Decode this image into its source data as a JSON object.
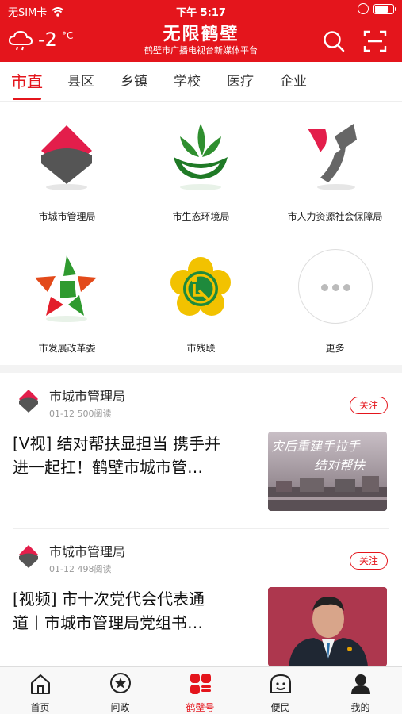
{
  "status_bar": {
    "carrier": "无SIM卡",
    "time": "下午 5:17"
  },
  "header": {
    "temperature": "-2",
    "unit": "°C",
    "app_name": "无限鹤壁",
    "subtitle": "鹤壁市广播电视台新媒体平台",
    "icons": {
      "weather": "cloud-icon",
      "search": "search-icon",
      "scan": "scan-icon"
    },
    "color": "#e4151c"
  },
  "tabs": [
    {
      "label": "市直",
      "active": true
    },
    {
      "label": "县区"
    },
    {
      "label": "乡镇"
    },
    {
      "label": "学校"
    },
    {
      "label": "医疗"
    },
    {
      "label": "企业"
    }
  ],
  "accounts": [
    {
      "label": "市城市管理局",
      "icon": "city-management-logo"
    },
    {
      "label": "市生态环境局",
      "icon": "ecology-logo"
    },
    {
      "label": "市人力资源社会保障局",
      "icon": "hr-social-security-logo"
    },
    {
      "label": "市发展改革委",
      "icon": "development-reform-logo"
    },
    {
      "label": "市残联",
      "icon": "disabled-federation-logo"
    },
    {
      "label": "更多",
      "icon": "more-icon"
    }
  ],
  "articles": [
    {
      "source": "市城市管理局",
      "date": "01-12",
      "reads": "500阅读",
      "follow": "关注",
      "title_line1": "[V视] 结对帮扶显担当 携手并",
      "title_line2": "进一起扛！鹤壁市城市管…",
      "thumb_text1": "灾后重建手拉手",
      "thumb_text2": "结对帮扶"
    },
    {
      "source": "市城市管理局",
      "date": "01-12",
      "reads": "498阅读",
      "follow": "关注",
      "title_line1": "[视频] 市十次党代会代表通",
      "title_line2": "道丨市城市管理局党组书…"
    }
  ],
  "bottom_nav": [
    {
      "label": "首页",
      "icon": "home-icon"
    },
    {
      "label": "问政",
      "icon": "star-chat-icon"
    },
    {
      "label": "鹤壁号",
      "icon": "hebi-account-icon",
      "active": true
    },
    {
      "label": "便民",
      "icon": "service-face-icon"
    },
    {
      "label": "我的",
      "icon": "user-icon"
    }
  ]
}
